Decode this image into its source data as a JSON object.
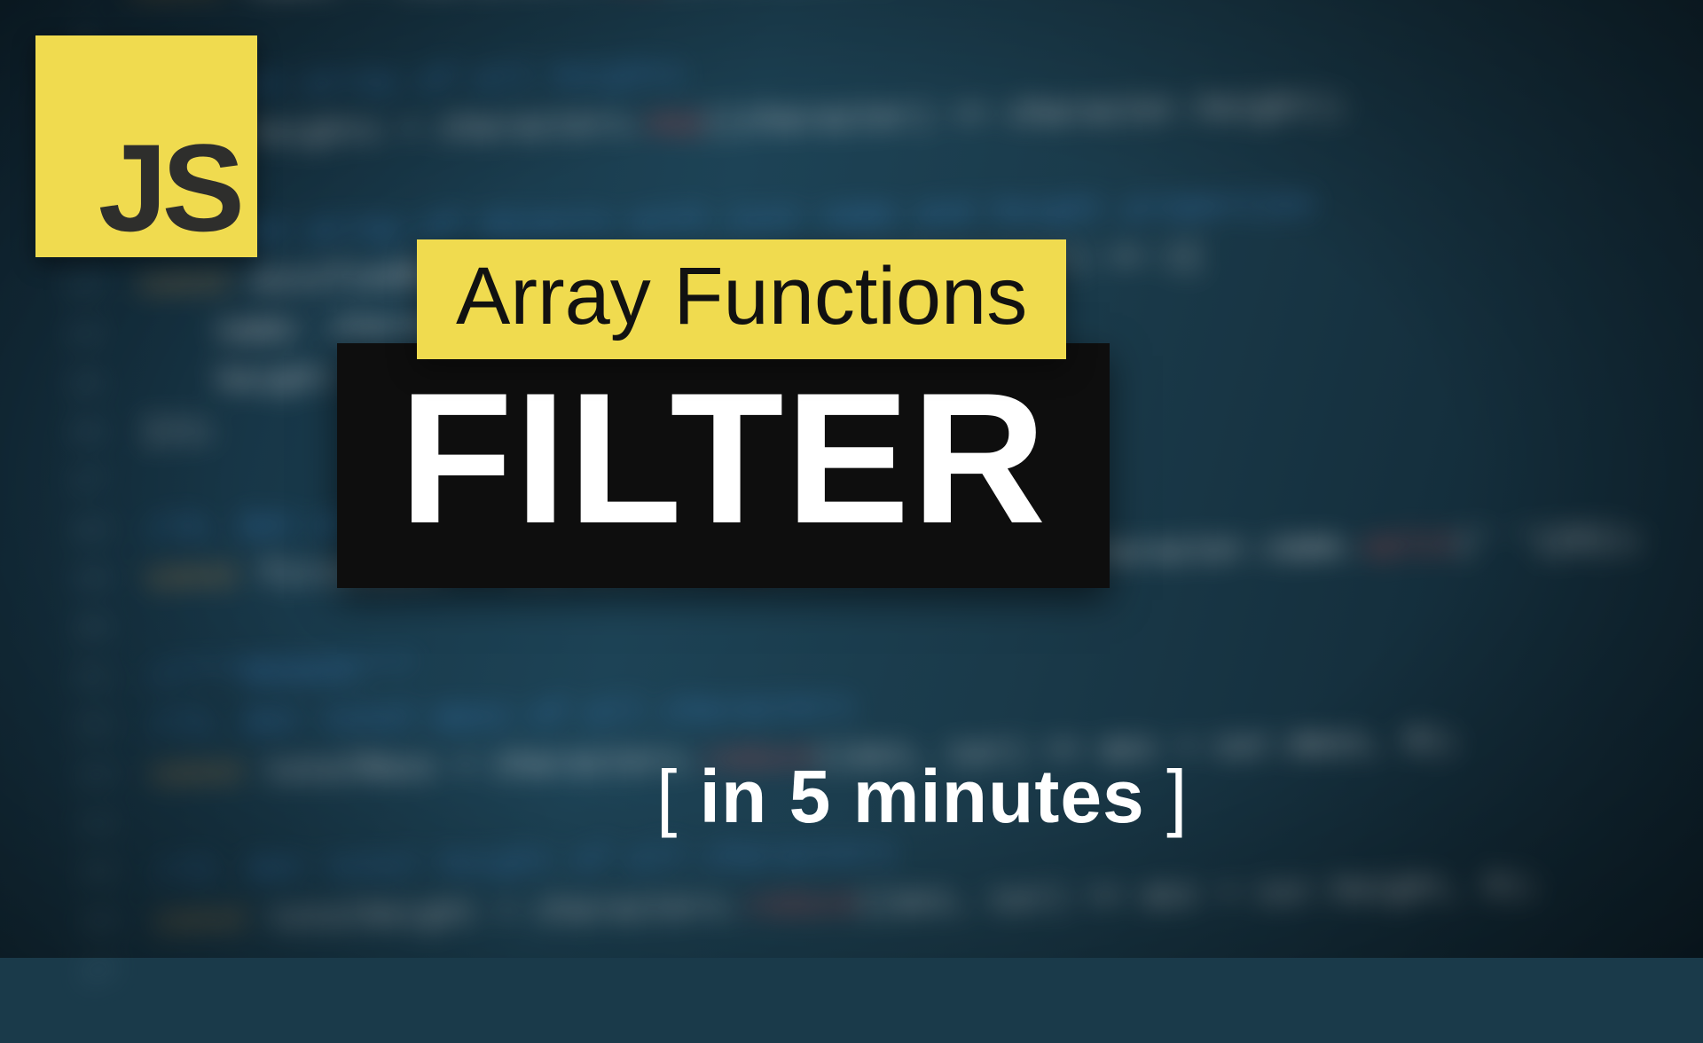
{
  "logo": {
    "text": "JS"
  },
  "title": {
    "subhead": "Array Functions",
    "main": "FILTER",
    "tagline_open": "[",
    "tagline_text": " in 5 minutes ",
    "tagline_close": "]"
  },
  "colors": {
    "accent_yellow": "#f0db4f",
    "dark_panel": "#0e0e0e",
    "bg_base": "#1a3a4a"
  },
  "background_code": {
    "lines": [
      {
        "n": "7",
        "t": "const names = characters.map((character) => character.name);"
      },
      {
        "n": "8",
        "t": ""
      },
      {
        "n": "9",
        "t": "//2. Get array of all heights"
      },
      {
        "n": "10",
        "t": "const heights = characters.map((character) => character.height);"
      },
      {
        "n": "11",
        "t": ""
      },
      {
        "n": "12",
        "t": "//3. Get array of objects with just name and height properties"
      },
      {
        "n": "13",
        "t": "const minifiedRecords = characters.map((character) => ({"
      },
      {
        "n": "14",
        "t": "    name: character.name,"
      },
      {
        "n": "15",
        "t": "    height: character.height,"
      },
      {
        "n": "16",
        "t": "}));"
      },
      {
        "n": "17",
        "t": ""
      },
      {
        "n": "18",
        "t": "//4. Get array of all first names"
      },
      {
        "n": "19",
        "t": "const firstNames = characters.map((character) => character.name.split(' ')[0]);"
      },
      {
        "n": "20",
        "t": ""
      },
      {
        "n": "21",
        "t": "//***REDUCE***"
      },
      {
        "n": "22",
        "t": "//1. Get total mass of all characters"
      },
      {
        "n": "23",
        "t": "const totalMass = characters.reduce((acc, cur) => acc + cur.mass, 0);"
      },
      {
        "n": "24",
        "t": ""
      },
      {
        "n": "25",
        "t": "//2. Get total height of all characters"
      },
      {
        "n": "26",
        "t": "const totalHeight = characters.reduce((acc, cur) => acc + cur.height, 0);"
      },
      {
        "n": "27",
        "t": ""
      }
    ]
  }
}
